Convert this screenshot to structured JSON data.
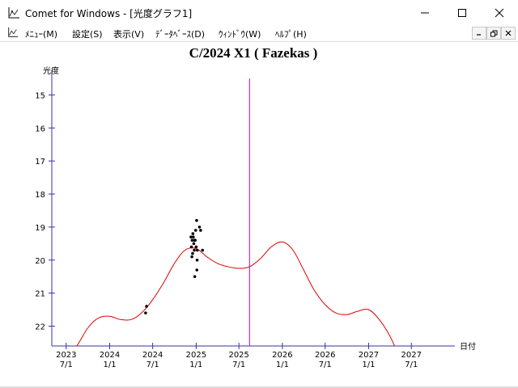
{
  "window": {
    "title": "Comet for Windows - [光度グラフ1]",
    "icon": "graph-doc-icon"
  },
  "menu": {
    "items": [
      {
        "label": "ﾒﾆｭｰ(M)"
      },
      {
        "label": "設定(S)"
      },
      {
        "label": "表示(V)"
      },
      {
        "label": "ﾃﾞｰﾀﾍﾞｰｽ(D)"
      },
      {
        "label": "ｳｨﾝﾄﾞｳ(W)"
      },
      {
        "label": "ﾍﾙﾌﾟ(H)"
      }
    ]
  },
  "chart_data": {
    "type": "scatter",
    "title": "C/2024 X1 ( Fazekas )",
    "ylabel": "光度",
    "xlabel": "日付",
    "y_ticks": [
      15,
      16,
      17,
      18,
      19,
      20,
      21,
      22
    ],
    "y_inverted": true,
    "ylim": [
      14.5,
      22.6
    ],
    "x_ticks": [
      {
        "date": "2023-07-01",
        "label": [
          "2023",
          "7/1"
        ]
      },
      {
        "date": "2024-01-01",
        "label": [
          "2024",
          "1/1"
        ]
      },
      {
        "date": "2024-07-01",
        "label": [
          "2024",
          "7/1"
        ]
      },
      {
        "date": "2025-01-01",
        "label": [
          "2025",
          "1/1"
        ]
      },
      {
        "date": "2025-07-01",
        "label": [
          "2025",
          "7/1"
        ]
      },
      {
        "date": "2026-01-01",
        "label": [
          "2026",
          "1/1"
        ]
      },
      {
        "date": "2026-07-01",
        "label": [
          "2026",
          "7/1"
        ]
      },
      {
        "date": "2027-01-01",
        "label": [
          "2027",
          "1/1"
        ]
      },
      {
        "date": "2027-07-01",
        "label": [
          "2027",
          "7/1"
        ]
      }
    ],
    "xlim": [
      "2023-05-01",
      "2028-01-01"
    ],
    "current_date": "2025-08-15",
    "colors": {
      "axis": "#3333aa",
      "curve": "#dd0000",
      "cursor": "#cc00cc",
      "points": "#000000"
    },
    "observations": [
      {
        "date": "2024-06-01",
        "mag": 21.6
      },
      {
        "date": "2024-06-05",
        "mag": 21.4
      },
      {
        "date": "2024-12-10",
        "mag": 19.3
      },
      {
        "date": "2024-12-12",
        "mag": 19.6
      },
      {
        "date": "2024-12-14",
        "mag": 19.9
      },
      {
        "date": "2024-12-15",
        "mag": 19.4
      },
      {
        "date": "2024-12-17",
        "mag": 19.8
      },
      {
        "date": "2024-12-18",
        "mag": 19.2
      },
      {
        "date": "2024-12-20",
        "mag": 19.3
      },
      {
        "date": "2024-12-22",
        "mag": 19.5
      },
      {
        "date": "2024-12-24",
        "mag": 19.7
      },
      {
        "date": "2024-12-25",
        "mag": 19.4
      },
      {
        "date": "2024-12-26",
        "mag": 20.5
      },
      {
        "date": "2024-12-28",
        "mag": 19.4
      },
      {
        "date": "2024-12-30",
        "mag": 19.1
      },
      {
        "date": "2025-01-01",
        "mag": 19.6
      },
      {
        "date": "2025-01-03",
        "mag": 18.8
      },
      {
        "date": "2025-01-04",
        "mag": 20.3
      },
      {
        "date": "2025-01-05",
        "mag": 20.0
      },
      {
        "date": "2025-01-06",
        "mag": 19.7
      },
      {
        "date": "2025-01-15",
        "mag": 19.0
      },
      {
        "date": "2025-01-20",
        "mag": 19.1
      },
      {
        "date": "2025-01-28",
        "mag": 19.7
      }
    ],
    "predicted_curve": [
      {
        "date": "2023-07-01",
        "mag": 23.0
      },
      {
        "date": "2023-08-15",
        "mag": 22.6
      },
      {
        "date": "2023-10-01",
        "mag": 22.05
      },
      {
        "date": "2023-11-15",
        "mag": 21.75
      },
      {
        "date": "2024-01-01",
        "mag": 21.7
      },
      {
        "date": "2024-02-15",
        "mag": 21.8
      },
      {
        "date": "2024-04-01",
        "mag": 21.8
      },
      {
        "date": "2024-05-15",
        "mag": 21.6
      },
      {
        "date": "2024-07-01",
        "mag": 21.2
      },
      {
        "date": "2024-08-15",
        "mag": 20.7
      },
      {
        "date": "2024-10-01",
        "mag": 20.1
      },
      {
        "date": "2024-11-15",
        "mag": 19.7
      },
      {
        "date": "2025-01-01",
        "mag": 19.65
      },
      {
        "date": "2025-02-15",
        "mag": 19.9
      },
      {
        "date": "2025-04-01",
        "mag": 20.1
      },
      {
        "date": "2025-05-15",
        "mag": 20.2
      },
      {
        "date": "2025-07-01",
        "mag": 20.25
      },
      {
        "date": "2025-08-15",
        "mag": 20.2
      },
      {
        "date": "2025-10-01",
        "mag": 19.95
      },
      {
        "date": "2025-11-15",
        "mag": 19.6
      },
      {
        "date": "2026-01-01",
        "mag": 19.45
      },
      {
        "date": "2026-02-15",
        "mag": 19.7
      },
      {
        "date": "2026-04-01",
        "mag": 20.3
      },
      {
        "date": "2026-05-15",
        "mag": 20.9
      },
      {
        "date": "2026-07-01",
        "mag": 21.35
      },
      {
        "date": "2026-08-15",
        "mag": 21.6
      },
      {
        "date": "2026-10-01",
        "mag": 21.65
      },
      {
        "date": "2026-11-15",
        "mag": 21.55
      },
      {
        "date": "2027-01-01",
        "mag": 21.5
      },
      {
        "date": "2027-02-15",
        "mag": 21.8
      },
      {
        "date": "2027-04-01",
        "mag": 22.3
      },
      {
        "date": "2027-05-15",
        "mag": 23.0
      }
    ]
  }
}
